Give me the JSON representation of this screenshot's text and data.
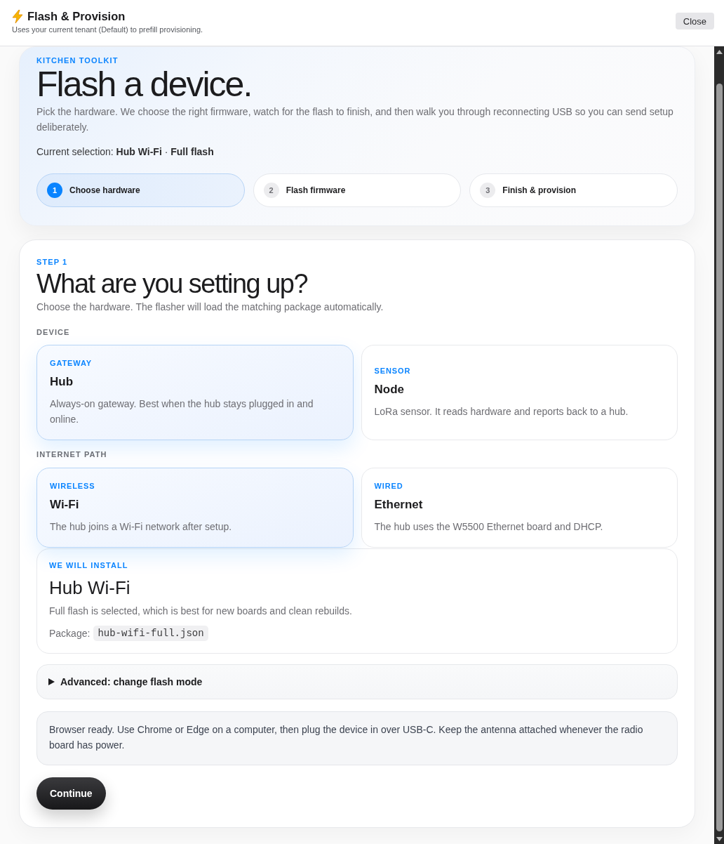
{
  "window": {
    "title": "Flash & Provision",
    "subtitle": "Uses your current tenant (Default) to prefill provisioning.",
    "close_button": "Close"
  },
  "hero": {
    "kicker": "KITCHEN TOOLKIT",
    "title": "Flash a device.",
    "description": "Pick the hardware. We choose the right firmware, watch for the flash to finish, and then walk you through reconnecting USB so you can send setup deliberately.",
    "selection": "Current selection: **Hub Wi-Fi** · **Full flash**"
  },
  "steps": [
    {
      "number": "1",
      "label": "Choose hardware",
      "selected": true
    },
    {
      "number": "2",
      "label": "Flash firmware",
      "selected": false
    },
    {
      "number": "3",
      "label": "Finish & provision",
      "selected": false
    }
  ],
  "step_panel": {
    "kicker": "STEP 1",
    "title": "What are you setting up?",
    "description": "Choose the hardware. The flasher will load the matching package automatically.",
    "groups": [
      {
        "label": "DEVICE",
        "options": [
          {
            "kicker": "GATEWAY",
            "title": "Hub",
            "description": "Always-on gateway. Best when the hub stays plugged in and online.",
            "selected": true
          },
          {
            "kicker": "SENSOR",
            "title": "Node",
            "description": "LoRa sensor. It reads hardware and reports back to a hub.",
            "selected": false
          }
        ]
      },
      {
        "label": "INTERNET PATH",
        "options": [
          {
            "kicker": "WIRELESS",
            "title": "Wi-Fi",
            "description": "The hub joins a Wi-Fi network after setup.",
            "selected": true
          },
          {
            "kicker": "WIRED",
            "title": "Ethernet",
            "description": "The hub uses the W5500 Ethernet board and DHCP.",
            "selected": false
          }
        ]
      }
    ],
    "install": {
      "kicker": "WE WILL INSTALL",
      "title": "Hub Wi-Fi",
      "description": "Full flash is selected, which is best for new boards and clean rebuilds.",
      "package_label": "Package:",
      "package": "hub-wifi-full.json"
    },
    "advanced": {
      "label": "Advanced: change flash mode",
      "expanded": false
    },
    "notice": "Browser ready. Use Chrome or Edge on a computer, then plug the device in over USB-C. Keep the antenna attached whenever the radio board has power.",
    "continue_button": "Continue"
  }
}
